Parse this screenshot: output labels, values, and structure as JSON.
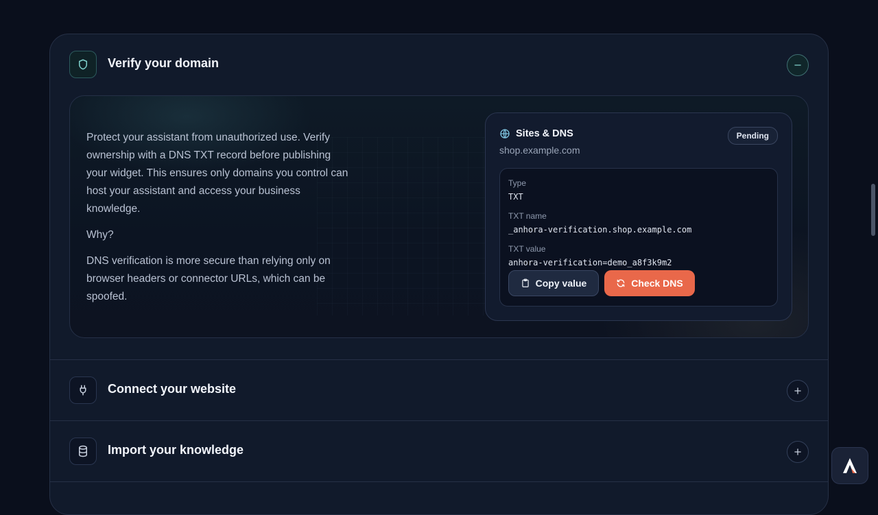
{
  "sections": {
    "verify": {
      "title": "Verify your domain",
      "icon": "shield-icon",
      "toggle_icon": "minus-icon",
      "description": [
        "Protect your assistant from unauthorized use. Verify ownership with a DNS TXT record before publishing your widget. This ensures only domains you control can host your assistant and access your business knowledge.",
        "Why?",
        "DNS verification is more secure than relying only on browser headers or connector URLs, which can be spoofed."
      ],
      "dns_card": {
        "title": "Sites & DNS",
        "icon": "globe-icon",
        "domain": "shop.example.com",
        "status": "Pending",
        "type_label": "Type",
        "type_value": "TXT",
        "name_label": "TXT name",
        "name_value": "_anhora-verification.shop.example.com",
        "value_label": "TXT value",
        "value_value": "anhora-verification=demo_a8f3k9m2",
        "copy_label": "Copy value",
        "check_label": "Check DNS"
      }
    },
    "connect": {
      "title": "Connect your website",
      "icon": "plug-icon",
      "toggle_icon": "plus-icon"
    },
    "import": {
      "title": "Import your knowledge",
      "icon": "database-icon",
      "toggle_icon": "plus-icon"
    }
  },
  "colors": {
    "background": "#0a0f1c",
    "card": "#111a2b",
    "accent_teal": "#5fb8b4",
    "accent_orange": "#e9684a"
  }
}
